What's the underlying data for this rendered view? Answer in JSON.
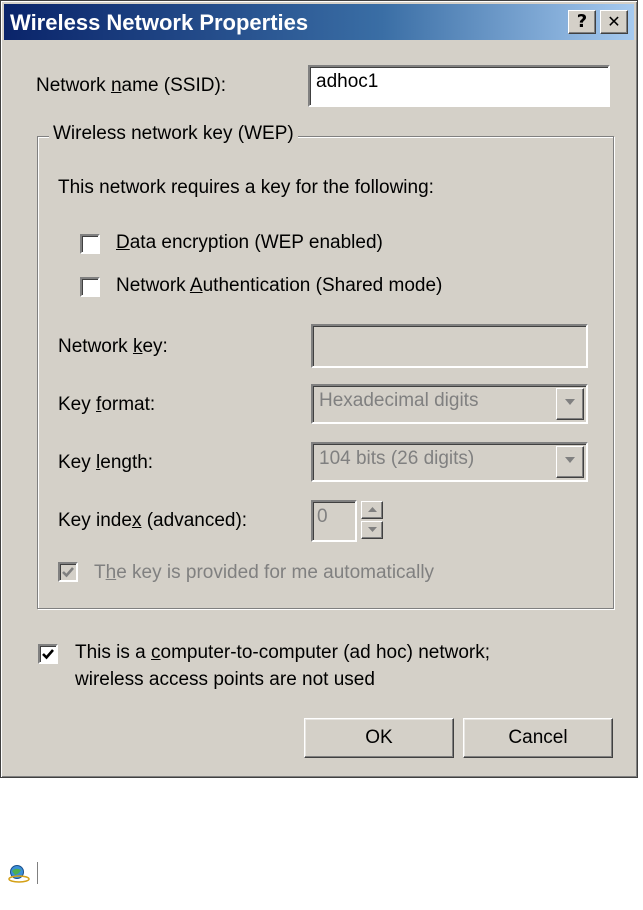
{
  "window": {
    "title": "Wireless Network Properties"
  },
  "titlebar": {
    "help_label": "?",
    "close_label": "✕"
  },
  "ssid": {
    "label_pre": "Network ",
    "label_mnemonic": "n",
    "label_post": "ame (SSID):",
    "value": "adhoc1"
  },
  "wep_group": {
    "legend": "Wireless network key (WEP)",
    "intro": "This network requires a key for the following:",
    "data_encryption": {
      "mnemonic": "D",
      "rest": "ata encryption (WEP enabled)",
      "checked": false
    },
    "network_auth": {
      "pre": "Network ",
      "mnemonic": "A",
      "rest": "uthentication (Shared mode)",
      "checked": false
    },
    "network_key": {
      "pre": "Network ",
      "mnemonic": "k",
      "post": "ey:",
      "value": ""
    },
    "key_format": {
      "pre": "Key ",
      "mnemonic": "f",
      "post": "ormat:",
      "value": "Hexadecimal digits"
    },
    "key_length": {
      "pre": "Key ",
      "mnemonic": "l",
      "post": "ength:",
      "value": "104 bits (26 digits)"
    },
    "key_index": {
      "pre": "Key inde",
      "mnemonic": "x",
      "post": " (advanced):",
      "value": "0"
    },
    "auto_key": {
      "pre": "T",
      "mnemonic": "h",
      "post": "e key is provided for me automatically",
      "checked": true
    }
  },
  "adhoc": {
    "line1_pre": "This is a ",
    "line1_mnemonic": "c",
    "line1_post": "omputer-to-computer (ad hoc) network;",
    "line2": "wireless access points are not used",
    "checked": true
  },
  "buttons": {
    "ok": "OK",
    "cancel": "Cancel"
  },
  "icons": {
    "titlebar_help": "help-icon",
    "titlebar_close": "close-icon",
    "footer": "network-globe-icon"
  }
}
